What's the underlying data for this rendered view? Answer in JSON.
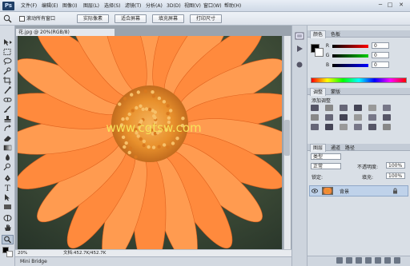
{
  "app": {
    "logo": "Ps",
    "menus": [
      "文件(F)",
      "编辑(E)",
      "图像(I)",
      "图层(L)",
      "选择(S)",
      "滤镜(T)",
      "分析(A)",
      "3D(D)",
      "视图(V)",
      "窗口(W)",
      "帮助(H)"
    ],
    "window_controls": {
      "minimize": "─",
      "maximize": "□",
      "close": "✕"
    }
  },
  "options_bar": {
    "checkbox_label": "滚动所有窗口",
    "buttons": [
      "实际像素",
      "适合屏幕",
      "填充屏幕",
      "打印尺寸"
    ]
  },
  "document": {
    "tab_title": "花.jpg @ 20%(RGB/8)",
    "watermark": "www.cgtsw.com",
    "zoom": "20%",
    "doc_info": "文档:452.7K/452.7K"
  },
  "mini_bridge": {
    "label": "Mini Bridge"
  },
  "panels": {
    "color": {
      "tab": "颜色",
      "tab2": "色板",
      "channels": [
        {
          "label": "R",
          "value": "0",
          "color": "#cc2222"
        },
        {
          "label": "G",
          "value": "0",
          "color": "#22aa22"
        },
        {
          "label": "B",
          "value": "0",
          "color": "#2244cc"
        }
      ]
    },
    "adjustments": {
      "tab": "调整",
      "tab2": "蒙版",
      "title": "添加调整"
    },
    "layers": {
      "tab": "图层",
      "tab2": "通道",
      "tab3": "路径",
      "kind_filter": "类型",
      "blend_mode": "正常",
      "opacity_label": "不透明度:",
      "opacity_value": "100%",
      "lock_label": "锁定:",
      "fill_label": "填充:",
      "fill_value": "100%",
      "items": [
        {
          "name": "背景",
          "visible": true,
          "locked": true
        }
      ]
    }
  },
  "colors": {
    "accent": "#1f3f66",
    "flower_orange": "#ff8a3d",
    "selected_layer": "#bfd2ea"
  }
}
